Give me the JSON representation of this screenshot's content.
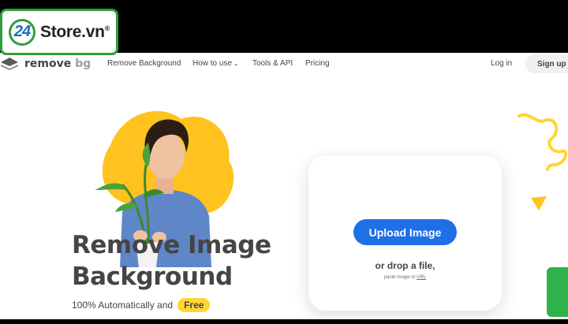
{
  "watermark": {
    "number": "24",
    "text": "Store.vn",
    "reg": "®"
  },
  "nav": {
    "logo_remove": "remove",
    "logo_bg": "bg",
    "links": [
      "Remove Background",
      "How to use",
      "Tools & API",
      "Pricing"
    ],
    "login": "Log in",
    "signup": "Sign up"
  },
  "hero": {
    "title_line1": "Remove Image",
    "title_line2": "Background",
    "subtitle": "100% Automatically and",
    "free": "Free"
  },
  "upload": {
    "button": "Upload Image",
    "drop": "or drop a file,",
    "paste_prefix": "paste image or",
    "paste_url": "URL"
  },
  "colors": {
    "accent_blue": "#1f6fe6",
    "yellow": "#ffd533",
    "text_dark": "#454545",
    "watermark_green": "#2f9e3a"
  }
}
